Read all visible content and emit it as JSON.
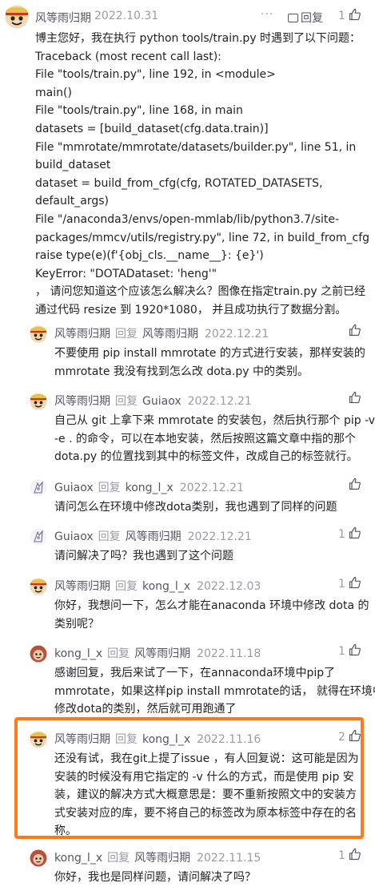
{
  "main": {
    "author": "风等雨归期",
    "date": "2022.10.31",
    "more_icon": "more-icon",
    "reply_label": "回复",
    "likes": "1",
    "lines": [
      "博主您好，我在执行 python tools/train.py 时遇到了以下问题：",
      "Traceback (most recent call last):",
      "File \"tools/train.py\", line 192, in <module>",
      "main()",
      "File \"tools/train.py\", line 168, in main",
      "datasets = [build_dataset(cfg.data.train)]",
      "File \"mmrotate/mmrotate/datasets/builder.py\", line 51, in",
      "build_dataset",
      "dataset = build_from_cfg(cfg, ROTATED_DATASETS,",
      "default_args)",
      "File \"/anaconda3/envs/open-mmlab/lib/python3.7/site-",
      "packages/mmcv/utils/registry.py\", line 72, in build_from_cfg",
      "raise type(e)(f'{obj_cls.__name__}: {e}')",
      "KeyError: \"DOTADataset: 'heng'\"",
      "， 请问您知道这个应该怎么解决么？图像在指定train.py 之前已经",
      "通过代码 resize 到 1920*1080， 并且成功执行了数据分割。"
    ]
  },
  "reply_word": "回复",
  "replies": [
    {
      "author": "风等雨归期",
      "to": "风等雨归期",
      "date": "2022.12.21",
      "likes": "",
      "lines": [
        "不要使用 pip install mmrotate 的方式进行安装，那样安装的",
        "mmrotate 我没有找到怎么改 dota.py 中的类别。"
      ]
    },
    {
      "author": "风等雨归期",
      "to": "Guiaox",
      "date": "2022.12.21",
      "likes": "",
      "lines": [
        "自己从 git 上拿下来 mmrotate 的安装包，然后执行那个 pip -v",
        "-e . 的命令，可以在本地安装，然后按照这篇文章中指的那个",
        "dota.py 的位置找到其中的标签文件，改成自己的标签就行。"
      ]
    },
    {
      "author": "Guiaox",
      "to": "kong_l_x",
      "date": "2022.12.21",
      "likes": "",
      "lines": [
        "请问怎么在环境中修改dota类别，我也遇到了同样的问题"
      ]
    },
    {
      "author": "Guiaox",
      "to": "风等雨归期",
      "date": "2022.12.21",
      "likes": "1",
      "lines": [
        "请问解决了吗？我也遇到了这个问题"
      ]
    },
    {
      "author": "风等雨归期",
      "to": "kong_l_x",
      "date": "2022.12.03",
      "likes": "1",
      "lines": [
        "你好，我想问一下，怎么才能在anaconda 环境中修改 dota 的",
        "类别呢？"
      ]
    },
    {
      "author": "kong_l_x",
      "to": "风等雨归期",
      "date": "2022.11.18",
      "likes": "1",
      "lines": [
        "感谢回复，我后来试了一下，在annaconda环境中pip了",
        "mmrotate，如果这样pip install mmrotate的话， 就得在环境中",
        "修改dota的类别，然后就可用跑通了"
      ]
    },
    {
      "author": "风等雨归期",
      "to": "kong_l_x",
      "date": "2022.11.16",
      "likes": "2",
      "lines": [
        "还没有试，我在git上提了issue ，有人回复说：这可能是因为",
        "安装的时候没有用它指定的 -v 什么的方式，而是使用 pip 安",
        "装，建议的解决方式大概意思是：要不重新按照文中的安装方",
        "式安装对应的库，要不将自己的标签改为原本标签中存在的名",
        "称。"
      ]
    },
    {
      "author": "kong_l_x",
      "to": "风等雨归期",
      "date": "2022.11.15",
      "likes": "1",
      "lines": [
        "你好，我也是同样问题，请问解决了吗？"
      ]
    }
  ],
  "icons": {
    "thumb": "thumbs-up-icon",
    "reply": "reply-bubble-icon"
  },
  "colors": {
    "highlight": "#ff7a1a",
    "meta": "#999aaa",
    "text": "#222226"
  }
}
